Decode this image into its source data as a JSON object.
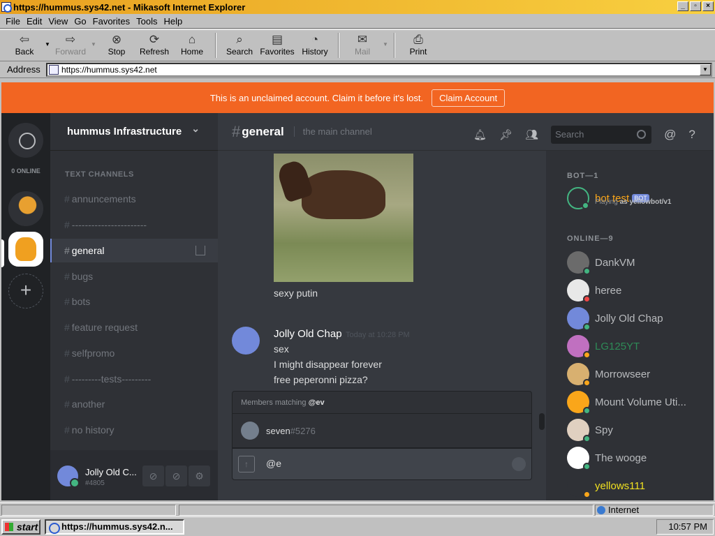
{
  "window": {
    "title": "https://hummus.sys42.net - Mikasoft Internet Explorer"
  },
  "menu": [
    "File",
    "Edit",
    "View",
    "Go",
    "Favorites",
    "Tools",
    "Help"
  ],
  "toolbar": {
    "back": "Back",
    "forward": "Forward",
    "stop": "Stop",
    "refresh": "Refresh",
    "home": "Home",
    "search": "Search",
    "favorites": "Favorites",
    "history": "History",
    "mail": "Mail",
    "print": "Print"
  },
  "address": {
    "label": "Address",
    "url": "https://hummus.sys42.net"
  },
  "banner": {
    "text": "This is an unclaimed account. Claim it before it's lost.",
    "button": "Claim Account"
  },
  "guilds": {
    "online_label": "0 ONLINE"
  },
  "server": {
    "name": "hummus Infrastructure",
    "category": "TEXT CHANNELS"
  },
  "channels": [
    {
      "name": "annuncements"
    },
    {
      "name": "-----------------------"
    },
    {
      "name": "general"
    },
    {
      "name": "bugs"
    },
    {
      "name": "bots"
    },
    {
      "name": "feature request"
    },
    {
      "name": "selfpromo"
    },
    {
      "name": "---------tests---------"
    },
    {
      "name": "another"
    },
    {
      "name": "no history"
    }
  ],
  "user": {
    "name": "Jolly Old C...",
    "discriminator": "#4805"
  },
  "header": {
    "channel": "general",
    "topic": "the main channel",
    "search_placeholder": "Search"
  },
  "messages": {
    "caption": "sexy putin",
    "author": "Jolly Old Chap",
    "time": "Today at 10:28 PM",
    "lines": [
      "sex",
      "I might disappear forever",
      "free peperonni pizza?"
    ]
  },
  "autocomplete": {
    "header": "Members matching",
    "query": "@ev",
    "name": "seven",
    "disc": "#5276"
  },
  "composer": {
    "value": "@e"
  },
  "members": {
    "bot_section": "BOT—1",
    "bot": {
      "name": "bot test",
      "tag": "BOT",
      "playing_prefix": "Playing ",
      "playing_game": "as yellowbot/v1"
    },
    "online_section": "ONLINE—9",
    "online": [
      {
        "name": "DankVM",
        "color": "#b9bbbe",
        "avatar": "#6b6b6b",
        "status": "#43b581"
      },
      {
        "name": "heree",
        "color": "#b9bbbe",
        "avatar": "#e8e8e8",
        "status": "#f04747"
      },
      {
        "name": "Jolly Old Chap",
        "color": "#b9bbbe",
        "avatar": "#7289da",
        "status": "#43b581"
      },
      {
        "name": "LG125YT",
        "color": "#2e8b57",
        "avatar": "#c070c0",
        "status": "#faa61a"
      },
      {
        "name": "Morrowseer",
        "color": "#b9bbbe",
        "avatar": "#d8b070",
        "status": "#faa61a"
      },
      {
        "name": "Mount Volume Uti...",
        "color": "#b9bbbe",
        "avatar": "#faa61a",
        "status": "#43b581"
      },
      {
        "name": "Spy",
        "color": "#b9bbbe",
        "avatar": "#e0d0c0",
        "status": "#43b581"
      },
      {
        "name": "The wooge",
        "color": "#b9bbbe",
        "avatar": "#ffffff",
        "status": "#43b581"
      },
      {
        "name": "yellows111",
        "color": "#f0e020",
        "avatar": "#2f3136",
        "status": "#faa61a"
      }
    ]
  },
  "statusbar": {
    "zone": "Internet"
  },
  "taskbar": {
    "start": "start",
    "item": "https://hummus.sys42.n...",
    "clock": "10:57 PM"
  }
}
